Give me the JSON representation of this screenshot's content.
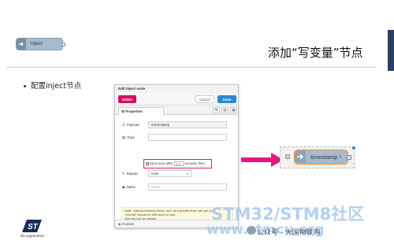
{
  "slide": {
    "title": "添加“写变量”节点",
    "bullet": "配置inject节点",
    "mini_node_label": "inject",
    "st_tagline": "life.augmented"
  },
  "dialog": {
    "header": "Edit inject node",
    "delete_label": "Delete",
    "cancel_label": "Cancel",
    "done_label": "Done",
    "tab_properties": "Properties",
    "payload_label": "Payload",
    "payload_value": "timestamp",
    "topic_label": "Topic",
    "topic_value": "",
    "inject_once_pre": "Inject once after",
    "inject_once_value": "0.1",
    "inject_once_post": "seconds, then",
    "repeat_label": "Repeat",
    "repeat_value": "none",
    "name_label": "Name",
    "name_placeholder": "Name",
    "note_line1": "Note: \"interval between times\" and \"at a specific time\" will use cron.",
    "note_line2": "\"interval\" should be 596 hours or less.",
    "note_line3": "See info box for details.",
    "footer_label": "Enabled"
  },
  "flow": {
    "node_label": "timestamp",
    "changed_marker": "¹"
  },
  "watermark": {
    "line1": "STM32/STM8社区",
    "line2": "www.stmcu.org",
    "wechat": "公众号 · 大国物联网"
  },
  "colors": {
    "accent_magenta": "#e2197f",
    "node_fill": "#a6bbcf",
    "node_selected_border": "#ff8a1f",
    "done_blue": "#2d89d6",
    "title_bar": "#2b3f63"
  },
  "icons": {
    "inject_port": "arrow-right-icon",
    "payload": "list-icon",
    "topic": "tasks-icon",
    "repeat": "repeat-icon",
    "name": "tag-icon",
    "settings": "gear-icon",
    "description": "file-icon"
  }
}
